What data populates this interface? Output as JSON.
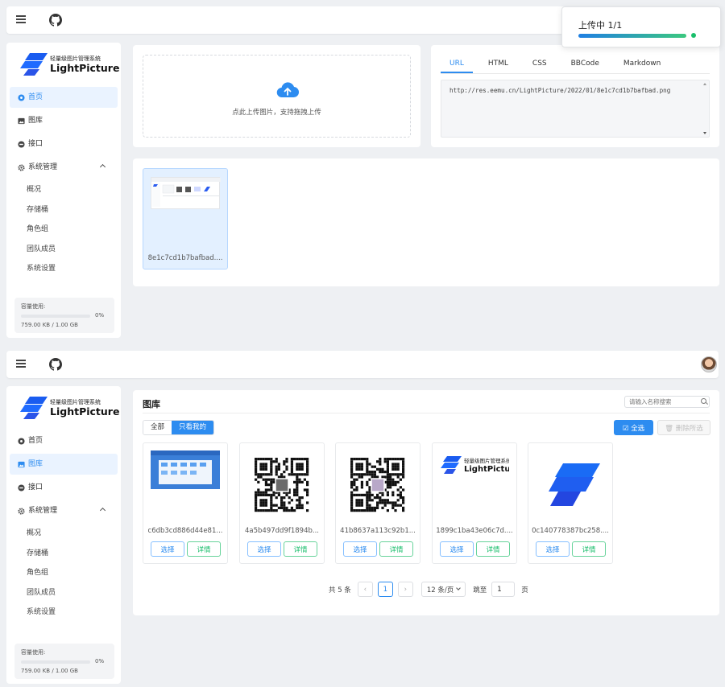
{
  "brand": {
    "subtitle": "轻量级图片管理系统",
    "name": "LightPicture"
  },
  "icons": {
    "menu": "menu-icon",
    "github": "github-icon",
    "upload": "cloud-upload-icon",
    "search": "search-icon"
  },
  "colors": {
    "accent": "#2d8cf0",
    "success": "#19be6b"
  },
  "nav": {
    "home": "首页",
    "gallery": "图库",
    "api": "接口",
    "system": "系统管理",
    "sub": [
      "概况",
      "存储桶",
      "角色组",
      "团队成员",
      "系统设置"
    ]
  },
  "storage_top": {
    "label": "容量使用:",
    "percent": "0%",
    "size": "759.00 KB / 1.00 GB"
  },
  "storage_bottom": {
    "label": "容量使用:",
    "percent": "0%",
    "size": "759.00 KB / 1.00 GB"
  },
  "upload": {
    "hint": "点此上传图片，支持拖拽上传"
  },
  "link_tabs": [
    "URL",
    "HTML",
    "CSS",
    "BBCode",
    "Markdown"
  ],
  "link_value": "http://res.eemu.cn/LightPicture/2022/01/8e1c7cd1b7bafbad.png",
  "result": {
    "name": "8e1c7cd1b7bafbad...."
  },
  "toast": {
    "title": "上传中 1/1",
    "progress": 1.0
  },
  "gallery": {
    "title": "图库",
    "search_placeholder": "请输入名称搜索",
    "filter": [
      "全部",
      "只看我的"
    ],
    "select_all": "全选",
    "delete_selected": "删除所选",
    "btn_select": "选择",
    "btn_detail": "详情",
    "items": [
      {
        "name": "c6db3cd886d44e81...",
        "type": "screenshot"
      },
      {
        "name": "4a5b497dd9f1894b...",
        "type": "qr"
      },
      {
        "name": "41b8637a113c92b1...",
        "type": "qr"
      },
      {
        "name": "1899c1ba43e06c7d....",
        "type": "logo-text"
      },
      {
        "name": "0c140778387bc258....",
        "type": "logo-mark"
      }
    ]
  },
  "pager": {
    "total": "共 5 条",
    "page": "1",
    "page_size": "12 条/页",
    "jump_label": "跳至",
    "jump_value": "1",
    "page_unit": "页",
    "prev": "‹",
    "next": "›"
  }
}
